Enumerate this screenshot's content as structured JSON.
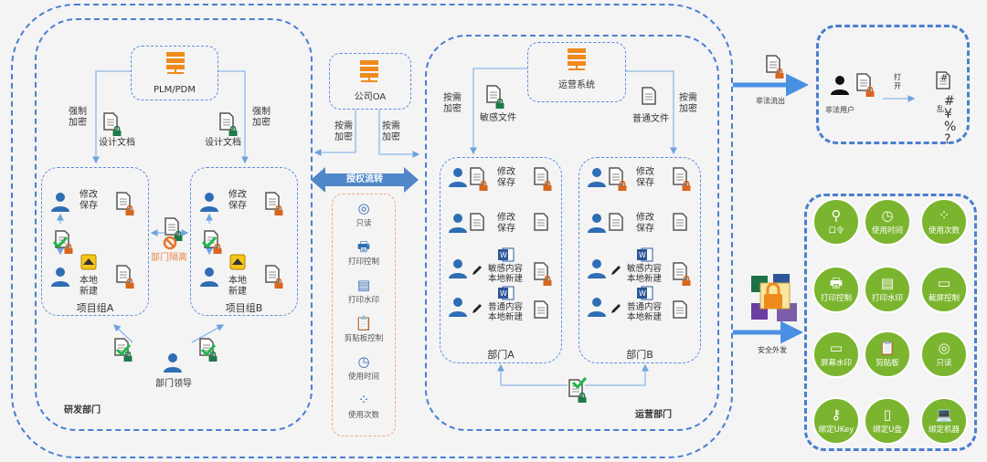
{
  "rd_dept": {
    "label": "研发部门",
    "plm": "PLM/PDM",
    "force_encrypt": "强制\n加密",
    "design_doc": "设计文档",
    "group_a": "项目组A",
    "group_b": "项目组B",
    "modify_save": "修改\n保存",
    "local_new": "本地\n新建",
    "isolation": "部门隔离",
    "leader": "部门领导"
  },
  "oa": {
    "label": "公司OA",
    "on_demand_left": "按需\n加密",
    "on_demand_right": "按需\n加密",
    "auth_flow": "授权流转",
    "controls": [
      "只读",
      "打印控制",
      "打印水印",
      "剪贴板控制",
      "使用时间",
      "使用次数"
    ]
  },
  "ops_dept": {
    "label": "运营部门",
    "system": "运营系统",
    "on_demand_left": "按需\n加密",
    "on_demand_right": "按需\n加密",
    "sensitive_file": "敏感文件",
    "normal_file": "普通文件",
    "dept_a": "部门A",
    "dept_b": "部门B",
    "rows": [
      "修改\n保存",
      "修改\n保存",
      "敏感内容\n本地新建",
      "普通内容\n本地新建"
    ]
  },
  "illegal": {
    "flow_label": "非法流出",
    "user": "非法用户",
    "open": "打\n开",
    "garbled": "乱",
    "garbled_chars": "#\n¥\n%\n?"
  },
  "external": {
    "label": "安全外发",
    "features": [
      "口令",
      "使用时间",
      "使用次数",
      "打印控制",
      "打印水印",
      "截屏控制",
      "屏幕水印",
      "剪贴板",
      "只读",
      "绑定UKey",
      "绑定U盘",
      "绑定机器"
    ]
  },
  "colors": {
    "dash": "#4a7fd0",
    "person": "#2f6db5",
    "lock_orange": "#d9651f",
    "lock_green": "#1f7a4a",
    "server": "#f08a1c",
    "feature_green": "#7bb52f",
    "orange_dash": "#f5a878"
  }
}
